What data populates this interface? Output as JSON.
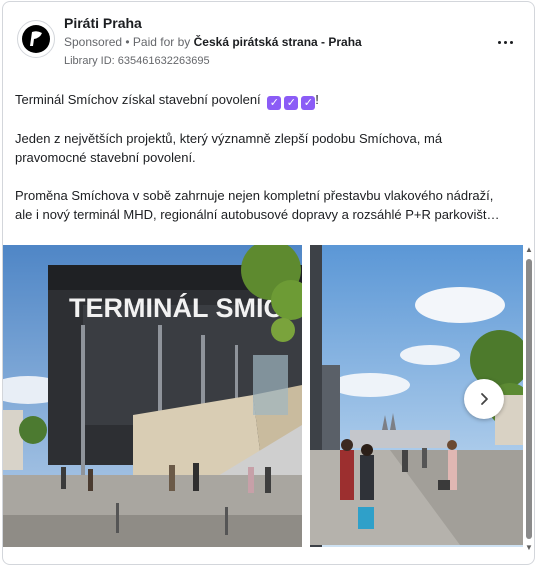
{
  "post": {
    "page_name": "Piráti Praha",
    "sponsored": "Sponsored",
    "paid_for_prefix": "• Paid for by",
    "payer": "Česká pirátská strana - Praha",
    "library_id": "Library ID: 635461632263695",
    "text": {
      "headline": "Terminál Smíchov získal stavební povolení",
      "headline_end": "!",
      "paragraph2_line1": "Jeden z největších projektů, který významně zlepší podobu Smíchova, má",
      "paragraph2_line2": "pravomocné stavební povolení.",
      "paragraph3_line1": "Proměna Smíchova v sobě zahrnuje nejen kompletní přestavbu vlakového nádraží,",
      "paragraph3_line2": "ale i nový terminál MHD, regionální autobusové dopravy a rozsáhlé P+R parkovišt…"
    },
    "image1_sign": "TERMINÁL SMÍCHOV"
  },
  "colors": {
    "check_emoji": "#8b5cf6",
    "secondary_text": "#65676b",
    "border": "#d3d6db"
  },
  "icons": {
    "avatar": "pirate-flag-logo",
    "more": "more-dots-icon",
    "next": "chevron-right-icon",
    "check": "check-mark-button-emoji"
  }
}
